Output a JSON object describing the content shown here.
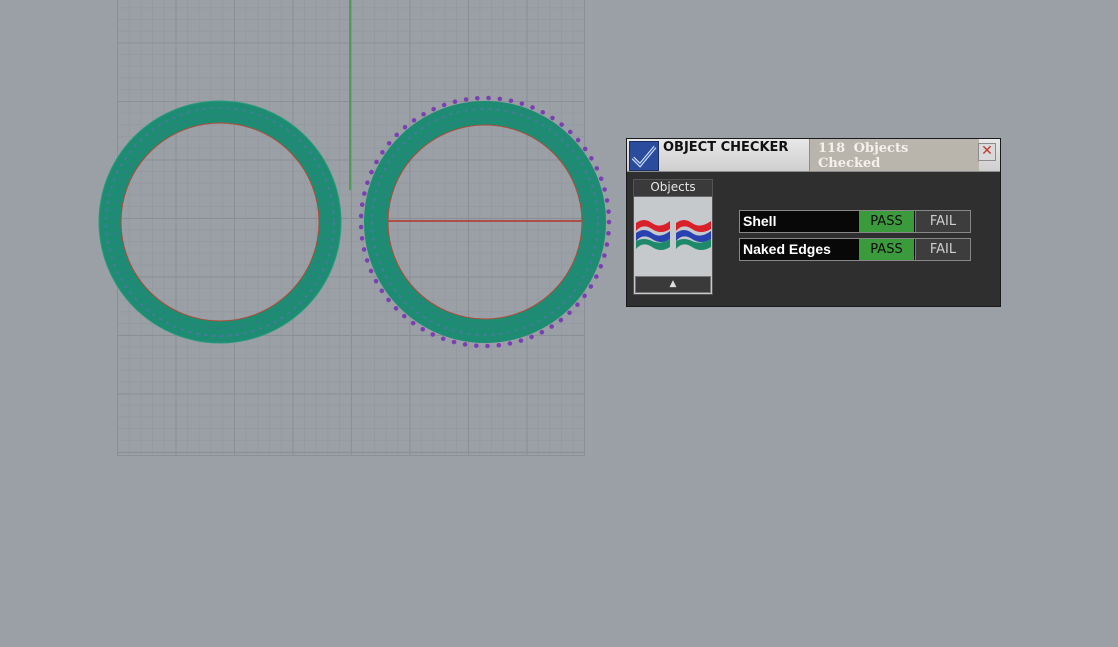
{
  "panel": {
    "title": "OBJECT CHECKER",
    "subtitle": "118  Objects Checked",
    "close_glyph": "✕",
    "objects_label": "Objects",
    "scroll_up_glyph": "▲",
    "checks": [
      {
        "label": "Shell",
        "pass": "PASS",
        "fail": "FAIL",
        "state": "pass"
      },
      {
        "label": "Naked Edges",
        "pass": "PASS",
        "fail": "FAIL",
        "state": "pass"
      }
    ]
  },
  "colors": {
    "viewport_bg": "#9aa0a6",
    "ring": "#1e8c72",
    "ring_edge": "#b04a3a",
    "control_points": "#7a3fb0",
    "x_axis": "#b0352a",
    "y_axis": "#3c9c3c",
    "pass_active": "#3b9a3b"
  },
  "icons": {
    "panel_logo": "checkmark-icon",
    "close": "close-icon",
    "scroll_up": "caret-up-icon"
  }
}
